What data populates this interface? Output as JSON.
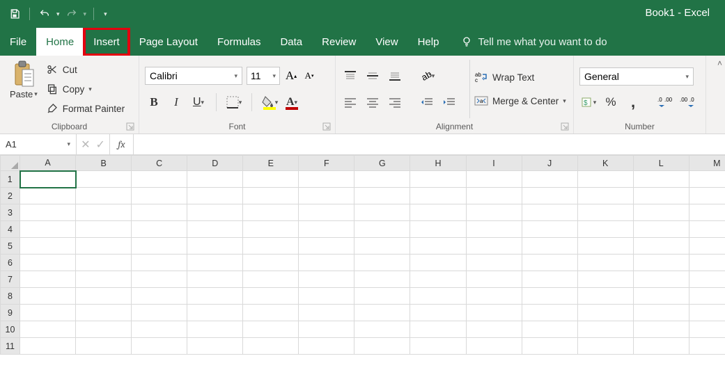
{
  "title": "Book1  -  Excel",
  "tabs": [
    "File",
    "Home",
    "Insert",
    "Page Layout",
    "Formulas",
    "Data",
    "Review",
    "View",
    "Help"
  ],
  "active_tab": "Home",
  "highlighted_tab": "Insert",
  "tell_me": "Tell me what you want to do",
  "clipboard": {
    "paste": "Paste",
    "cut": "Cut",
    "copy": "Copy",
    "format_painter": "Format Painter",
    "group_label": "Clipboard"
  },
  "font": {
    "name": "Calibri",
    "size": "11",
    "group_label": "Font",
    "fill_color": "#ffff00",
    "font_color": "#c00000"
  },
  "alignment": {
    "wrap": "Wrap Text",
    "merge": "Merge & Center",
    "group_label": "Alignment"
  },
  "number": {
    "format": "General",
    "group_label": "Number",
    "percent": "%",
    "comma": ","
  },
  "namebox": "A1",
  "fx": "fx",
  "formula": "",
  "columns": [
    "A",
    "B",
    "C",
    "D",
    "E",
    "F",
    "G",
    "H",
    "I",
    "J",
    "K",
    "L",
    "M"
  ],
  "rows": [
    "1",
    "2",
    "3",
    "4",
    "5",
    "6",
    "7",
    "8",
    "9",
    "10",
    "11"
  ],
  "selected_cell": {
    "col": "A",
    "row": "1"
  }
}
